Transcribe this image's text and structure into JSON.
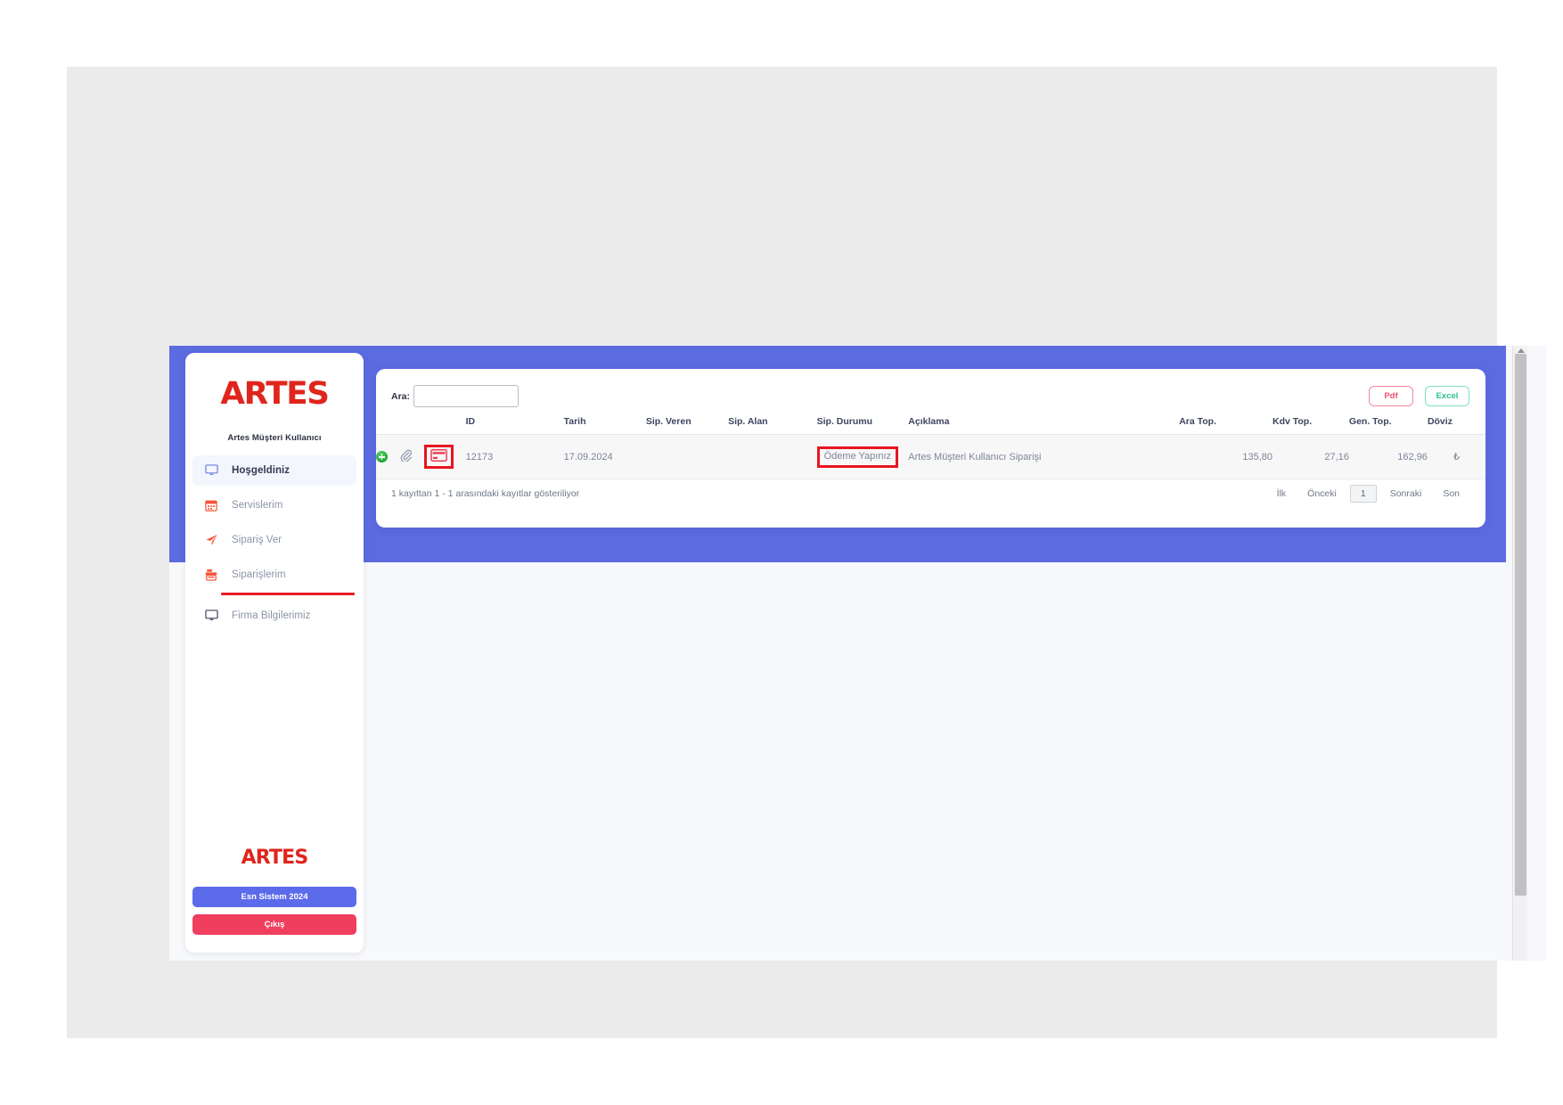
{
  "app": {
    "brand": "ARTES",
    "user_role": "Artes Müşteri Kullanıcı",
    "accent_blue": "#5c6be0",
    "accent_red": "#e0251c",
    "logout_red": "#ef3e5e"
  },
  "sidebar": {
    "logo": "ARTES",
    "subtitle": "Artes Müşteri Kullanıcı",
    "items": [
      {
        "label": "Hoşgeldiniz",
        "icon": "monitor-icon",
        "active": true,
        "underlined": false
      },
      {
        "label": "Servislerim",
        "icon": "calendar-icon",
        "active": false,
        "underlined": false
      },
      {
        "label": "Sipariş Ver",
        "icon": "paper-plane-icon",
        "active": false,
        "underlined": false
      },
      {
        "label": "Siparişlerim",
        "icon": "cash-register-icon",
        "active": false,
        "underlined": true
      },
      {
        "label": "Firma Bilgilerimiz",
        "icon": "monitor-icon",
        "active": false,
        "underlined": false
      }
    ],
    "footer_logo": "ARTES",
    "version_button": "Esn Sistem 2024",
    "logout_button": "Çıkış"
  },
  "toolbar": {
    "search_label": "Ara:",
    "search_value": "",
    "search_placeholder": "",
    "pdf_button": "Pdf",
    "excel_button": "Excel"
  },
  "table": {
    "columns": [
      {
        "key": "actions",
        "label": ""
      },
      {
        "key": "id",
        "label": "ID"
      },
      {
        "key": "tarih",
        "label": "Tarih"
      },
      {
        "key": "veren",
        "label": "Sip. Veren"
      },
      {
        "key": "alan",
        "label": "Sip. Alan"
      },
      {
        "key": "durum",
        "label": "Sip. Durumu"
      },
      {
        "key": "aciklama",
        "label": "Açıklama"
      },
      {
        "key": "ara",
        "label": "Ara Top."
      },
      {
        "key": "kdv",
        "label": "Kdv Top."
      },
      {
        "key": "gen",
        "label": "Gen. Top."
      },
      {
        "key": "doviz",
        "label": "Döviz"
      }
    ],
    "rows": [
      {
        "id": "12173",
        "tarih": "17.09.2024",
        "veren": "",
        "alan": "",
        "durum": "Ödeme Yapınız",
        "aciklama": "Artes Müşteri Kullanıcı Siparişi",
        "ara": "135,80",
        "kdv": "27,16",
        "gen": "162,96",
        "doviz": "₺",
        "row_icons": [
          "add-icon",
          "attachment-icon",
          "payment-card-icon"
        ]
      }
    ]
  },
  "footer": {
    "records_info": "1 kayıttan 1 - 1 arasındaki kayıtlar gösteriliyor",
    "pagination": {
      "first": "İlk",
      "previous": "Önceki",
      "current_page": "1",
      "next": "Sonraki",
      "last": "Son"
    }
  },
  "annotations": {
    "highlight_color": "#e8151f",
    "highlighted_elements": [
      "payment-card-icon",
      "order-status-cell",
      "sidebar-item-siparislerim"
    ]
  }
}
